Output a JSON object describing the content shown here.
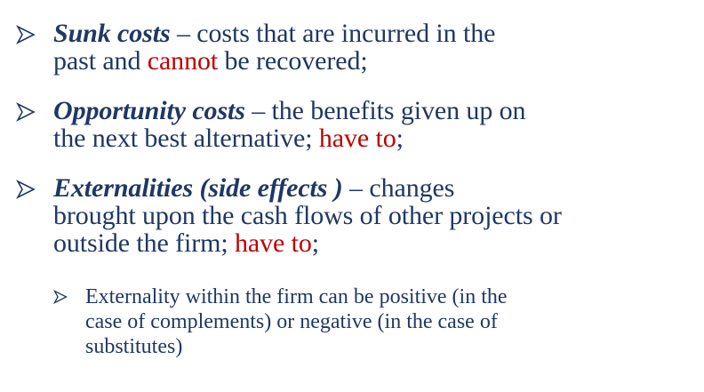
{
  "bullets": [
    {
      "term": "Sunk costs",
      "sep": " – ",
      "line1": "costs that are incurred in the",
      "line2a": "past and ",
      "highlight": "cannot",
      "line2b": " be recovered;"
    },
    {
      "term": "Opportunity costs",
      "sep": " – ",
      "line1": "the benefits given up on",
      "line2a": "the next best alternative; ",
      "highlight": "have to",
      "line2b": ";"
    },
    {
      "term": "Externalities (side effects )",
      "sep": " – ",
      "line1": "changes",
      "line2": "brought upon the cash flows of other projects or",
      "line3a": "outside the firm; ",
      "highlight": "have to",
      "line3b": ";"
    }
  ],
  "sub_bullet": {
    "line1": "Externality within the firm can be positive (in the",
    "line2": "case of complements) or negative (in the case of",
    "line3": "substitutes)"
  },
  "colors": {
    "text": "#1f3864",
    "highlight": "#c00000"
  },
  "icons": {
    "bullet": "arrow-bullet-icon"
  }
}
